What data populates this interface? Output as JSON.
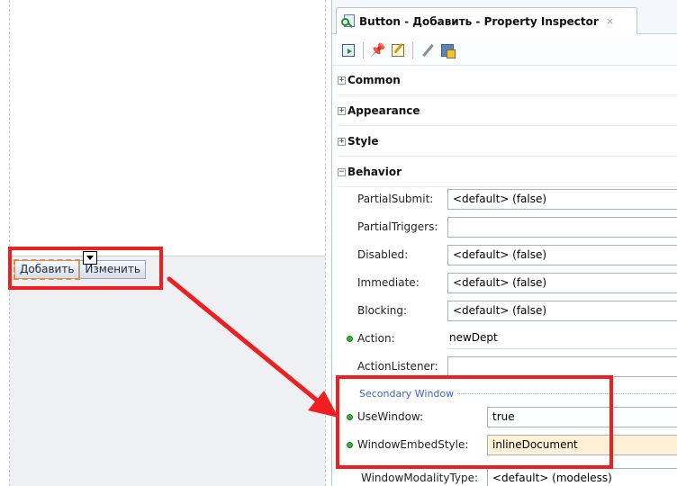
{
  "canvas": {
    "buttons": [
      {
        "label": "Добавить",
        "selected": true
      },
      {
        "label": "Изменить",
        "selected": false
      }
    ]
  },
  "inspector": {
    "tab_title": "Button - Добавить - Property Inspector",
    "tab_close": "×",
    "toolbar": [
      "select-icon",
      "pin-icon",
      "edit-icon",
      "pencil-icon",
      "bind-icon"
    ],
    "sections": [
      {
        "label": "Common",
        "toggle": "+"
      },
      {
        "label": "Appearance",
        "toggle": "+"
      },
      {
        "label": "Style",
        "toggle": "+"
      },
      {
        "label": "Behavior",
        "toggle": "−"
      }
    ],
    "properties": [
      {
        "label": "PartialSubmit:",
        "value": "<default> (false)"
      },
      {
        "label": "PartialTriggers:",
        "value": ""
      },
      {
        "label": "Disabled:",
        "value": "<default> (false)"
      },
      {
        "label": "Immediate:",
        "value": "<default> (false)"
      },
      {
        "label": "Blocking:",
        "value": "<default> (false)"
      },
      {
        "label": "Action:",
        "value": "newDept"
      },
      {
        "label": "ActionListener:",
        "value": ""
      }
    ],
    "secondary_window": {
      "header": "Secondary Window",
      "properties": [
        {
          "label": "UseWindow:",
          "value": "true"
        },
        {
          "label": "WindowEmbedStyle:",
          "value": "inlineDocument"
        },
        {
          "label": "WindowModalityType:",
          "value": "<default> (modeless)"
        }
      ]
    }
  },
  "colors": {
    "highlight": "#ef1f1f",
    "selection_outline": "#f08a2c",
    "set_value_dot": "#3bb23b",
    "group_header": "#3a66c4"
  }
}
